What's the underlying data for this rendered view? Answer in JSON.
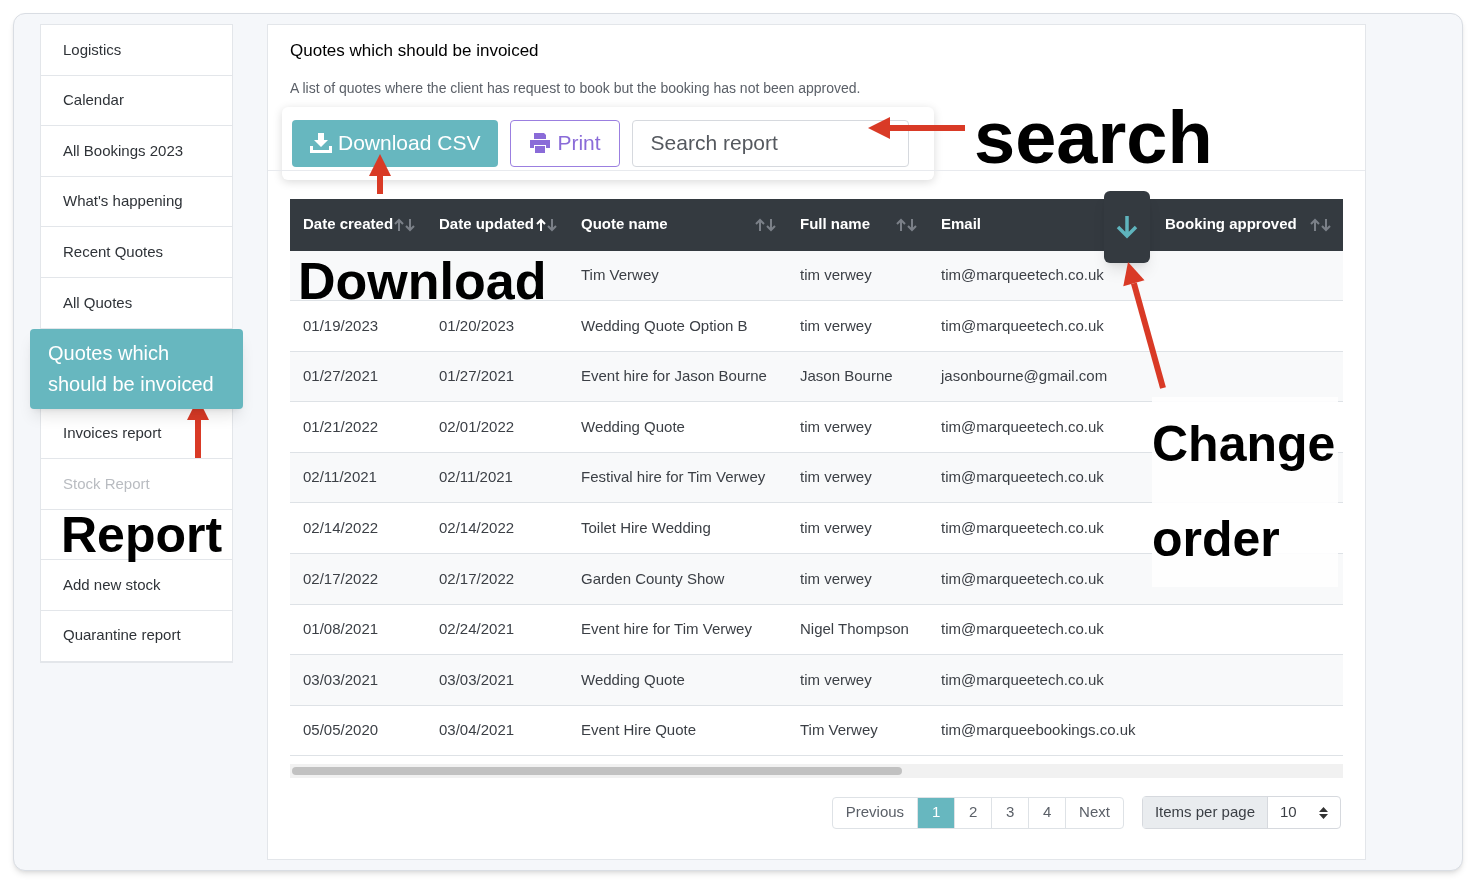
{
  "sidebar": {
    "items": [
      {
        "kind": "link",
        "label": "Logistics",
        "selected": false
      },
      {
        "kind": "link",
        "label": "Calendar",
        "selected": false
      },
      {
        "kind": "link",
        "label": "All Bookings 2023",
        "selected": false
      },
      {
        "kind": "link",
        "label": "What's happening",
        "selected": false
      },
      {
        "kind": "link",
        "label": "Recent Quotes",
        "selected": false
      },
      {
        "kind": "link",
        "label": "All Quotes",
        "selected": false
      },
      {
        "kind": "link",
        "label": "Quotes which should be invoiced",
        "selected": true
      },
      {
        "kind": "link",
        "label": "Invoices report",
        "selected": false
      },
      {
        "kind": "link",
        "label": "Stock Report",
        "selected": false,
        "disabled": true
      },
      {
        "kind": "annotation",
        "label": "Report"
      },
      {
        "kind": "link",
        "label": "Add new stock",
        "selected": false
      },
      {
        "kind": "link",
        "label": "Quarantine report",
        "selected": false
      }
    ]
  },
  "main": {
    "title": "Quotes which should be invoiced",
    "description": "A list of quotes where the client has request to book but the booking has not been approved.",
    "toolbar": {
      "download_button": "Download CSV",
      "print_button": "Print",
      "search": {
        "placeholder": "Search report"
      },
      "search_annotation": "search",
      "download_annotation": "Download"
    },
    "table": {
      "columns": [
        {
          "label": "Date created",
          "sorted_ascending": false
        },
        {
          "label": "Date updated",
          "sorted_ascending": true
        },
        {
          "label": "Quote name",
          "sorted_ascending": false
        },
        {
          "label": "Full name",
          "sorted_ascending": false
        },
        {
          "label": "Email"
        },
        {
          "label": "Booking approved",
          "sorted_ascending": false
        }
      ],
      "sort_annotation": "Change order",
      "rows": [
        {
          "quote_name": "Tim Verwey",
          "full_name": "tim verwey",
          "email": "tim@marqueetech.co.uk"
        },
        {
          "date_created": "01/19/2023",
          "date_updated": "01/20/2023",
          "quote_name": "Wedding Quote Option B",
          "full_name": "tim verwey",
          "email": "tim@marqueetech.co.uk"
        },
        {
          "date_created": "01/27/2021",
          "date_updated": "01/27/2021",
          "quote_name": "Event hire for Jason Bourne",
          "full_name": "Jason Bourne",
          "email": "jasonbourne@gmail.com"
        },
        {
          "date_created": "01/21/2022",
          "date_updated": "02/01/2022",
          "quote_name": "Wedding Quote",
          "full_name": "tim verwey",
          "email": "tim@marqueetech.co.uk"
        },
        {
          "date_created": "02/11/2021",
          "date_updated": "02/11/2021",
          "quote_name": "Festival hire for Tim Verwey",
          "full_name": "tim verwey",
          "email": "tim@marqueetech.co.uk"
        },
        {
          "date_created": "02/14/2022",
          "date_updated": "02/14/2022",
          "quote_name": "Toilet Hire Wedding",
          "full_name": "tim verwey",
          "email": "tim@marqueetech.co.uk"
        },
        {
          "date_created": "02/17/2022",
          "date_updated": "02/17/2022",
          "quote_name": "Garden County Show",
          "full_name": "tim verwey",
          "email": "tim@marqueetech.co.uk"
        },
        {
          "date_created": "01/08/2021",
          "date_updated": "02/24/2021",
          "quote_name": "Event hire for Tim Verwey",
          "full_name": "Nigel Thompson",
          "email": "tim@marqueetech.co.uk"
        },
        {
          "date_created": "03/03/2021",
          "date_updated": "03/03/2021",
          "quote_name": "Wedding Quote",
          "full_name": "tim verwey",
          "email": "tim@marqueetech.co.uk"
        },
        {
          "date_created": "05/05/2020",
          "date_updated": "03/04/2021",
          "quote_name": "Event Hire Quote",
          "full_name": "Tim Verwey",
          "email": "tim@marqueebookings.co.uk"
        }
      ]
    },
    "pagination": {
      "previous": "Previous",
      "pages": [
        {
          "label": "1",
          "selected": true
        },
        {
          "label": "2",
          "selected": false
        },
        {
          "label": "3",
          "selected": false
        },
        {
          "label": "4",
          "selected": false
        }
      ],
      "next": "Next",
      "items_label": "Items per page",
      "items_value": "10"
    }
  }
}
